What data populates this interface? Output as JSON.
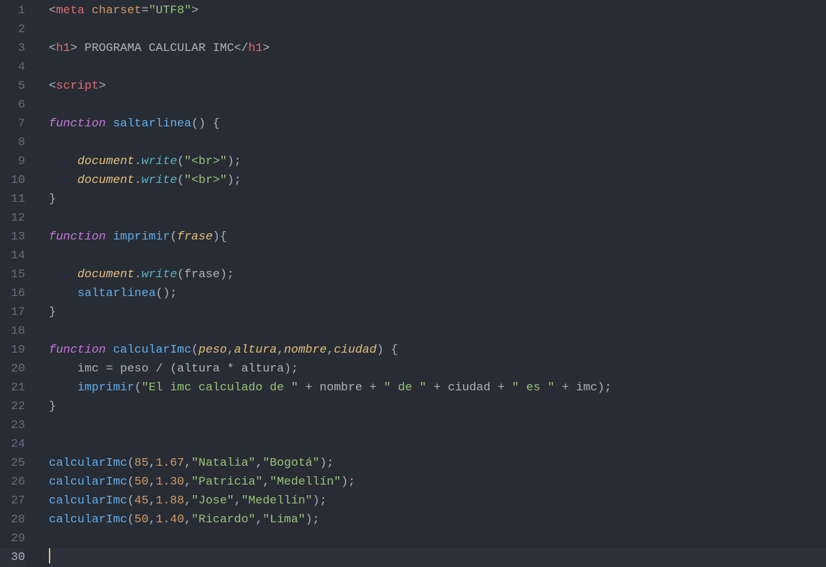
{
  "lineCount": 30,
  "currentLine": 30,
  "lines": [
    {
      "n": 1,
      "indent": 0,
      "tokens": [
        [
          "pun",
          "<"
        ],
        [
          "tag",
          "meta"
        ],
        [
          "txt",
          " "
        ],
        [
          "attr",
          "charset"
        ],
        [
          "pun",
          "="
        ],
        [
          "str",
          "\"UTF8\""
        ],
        [
          "pun",
          ">"
        ]
      ]
    },
    {
      "n": 2,
      "indent": 0,
      "tokens": []
    },
    {
      "n": 3,
      "indent": 0,
      "tokens": [
        [
          "pun",
          "<"
        ],
        [
          "tag",
          "h1"
        ],
        [
          "pun",
          ">"
        ],
        [
          "txt",
          " PROGRAMA CALCULAR IMC"
        ],
        [
          "pun",
          "</"
        ],
        [
          "tag",
          "h1"
        ],
        [
          "pun",
          ">"
        ]
      ]
    },
    {
      "n": 4,
      "indent": 0,
      "tokens": []
    },
    {
      "n": 5,
      "indent": 0,
      "tokens": [
        [
          "pun",
          "<"
        ],
        [
          "tag",
          "script"
        ],
        [
          "pun",
          ">"
        ]
      ]
    },
    {
      "n": 6,
      "indent": 0,
      "tokens": []
    },
    {
      "n": 7,
      "indent": 0,
      "tokens": [
        [
          "key",
          "function"
        ],
        [
          "txt",
          " "
        ],
        [
          "fn",
          "saltarlinea"
        ],
        [
          "pun",
          "() {"
        ]
      ]
    },
    {
      "n": 8,
      "indent": 0,
      "tokens": []
    },
    {
      "n": 9,
      "indent": 0,
      "tokens": [
        [
          "txt",
          "    "
        ],
        [
          "obj",
          "document"
        ],
        [
          "pun",
          "."
        ],
        [
          "fni",
          "write"
        ],
        [
          "pun",
          "("
        ],
        [
          "str",
          "\"<br>\""
        ],
        [
          "pun",
          ");"
        ]
      ]
    },
    {
      "n": 10,
      "indent": 0,
      "tokens": [
        [
          "txt",
          "    "
        ],
        [
          "obj",
          "document"
        ],
        [
          "pun",
          "."
        ],
        [
          "fni",
          "write"
        ],
        [
          "pun",
          "("
        ],
        [
          "str",
          "\"<br>\""
        ],
        [
          "pun",
          ");"
        ]
      ]
    },
    {
      "n": 11,
      "indent": 0,
      "tokens": [
        [
          "pun",
          "}"
        ]
      ]
    },
    {
      "n": 12,
      "indent": 0,
      "tokens": []
    },
    {
      "n": 13,
      "indent": 0,
      "tokens": [
        [
          "key",
          "function"
        ],
        [
          "txt",
          " "
        ],
        [
          "fn",
          "imprimir"
        ],
        [
          "pun",
          "("
        ],
        [
          "param",
          "frase"
        ],
        [
          "pun",
          "){  "
        ]
      ]
    },
    {
      "n": 14,
      "indent": 0,
      "tokens": []
    },
    {
      "n": 15,
      "indent": 0,
      "tokens": [
        [
          "txt",
          "    "
        ],
        [
          "obj",
          "document"
        ],
        [
          "pun",
          "."
        ],
        [
          "fni",
          "write"
        ],
        [
          "pun",
          "("
        ],
        [
          "txt",
          "frase"
        ],
        [
          "pun",
          ");"
        ]
      ]
    },
    {
      "n": 16,
      "indent": 0,
      "tokens": [
        [
          "txt",
          "    "
        ],
        [
          "fn",
          "saltarlinea"
        ],
        [
          "pun",
          "();"
        ]
      ]
    },
    {
      "n": 17,
      "indent": 0,
      "tokens": [
        [
          "pun",
          "}"
        ]
      ]
    },
    {
      "n": 18,
      "indent": 0,
      "tokens": []
    },
    {
      "n": 19,
      "indent": 0,
      "tokens": [
        [
          "key",
          "function"
        ],
        [
          "txt",
          " "
        ],
        [
          "fn",
          "calcularImc"
        ],
        [
          "pun",
          "("
        ],
        [
          "param",
          "peso"
        ],
        [
          "pun",
          ","
        ],
        [
          "param",
          "altura"
        ],
        [
          "pun",
          ","
        ],
        [
          "param",
          "nombre"
        ],
        [
          "pun",
          ","
        ],
        [
          "param",
          "ciudad"
        ],
        [
          "pun",
          ") {"
        ]
      ]
    },
    {
      "n": 20,
      "indent": 0,
      "tokens": [
        [
          "txt",
          "    imc "
        ],
        [
          "pun",
          "="
        ],
        [
          "txt",
          " peso "
        ],
        [
          "pun",
          "/"
        ],
        [
          "txt",
          " "
        ],
        [
          "pun",
          "("
        ],
        [
          "txt",
          "altura "
        ],
        [
          "pun",
          "*"
        ],
        [
          "txt",
          " altura"
        ],
        [
          "pun",
          ");"
        ]
      ]
    },
    {
      "n": 21,
      "indent": 0,
      "tokens": [
        [
          "txt",
          "    "
        ],
        [
          "fn",
          "imprimir"
        ],
        [
          "pun",
          "("
        ],
        [
          "str",
          "\"El imc calculado de \""
        ],
        [
          "txt",
          " "
        ],
        [
          "pun",
          "+"
        ],
        [
          "txt",
          " nombre "
        ],
        [
          "pun",
          "+"
        ],
        [
          "txt",
          " "
        ],
        [
          "str",
          "\" de \""
        ],
        [
          "txt",
          " "
        ],
        [
          "pun",
          "+"
        ],
        [
          "txt",
          " ciudad "
        ],
        [
          "pun",
          "+"
        ],
        [
          "txt",
          " "
        ],
        [
          "str",
          "\" es \""
        ],
        [
          "txt",
          " "
        ],
        [
          "pun",
          "+"
        ],
        [
          "txt",
          " imc"
        ],
        [
          "pun",
          ");"
        ]
      ]
    },
    {
      "n": 22,
      "indent": 0,
      "tokens": [
        [
          "pun",
          "}"
        ]
      ]
    },
    {
      "n": 23,
      "indent": 0,
      "tokens": []
    },
    {
      "n": 24,
      "indent": 0,
      "tokens": []
    },
    {
      "n": 25,
      "indent": 0,
      "tokens": [
        [
          "fn",
          "calcularImc"
        ],
        [
          "pun",
          "("
        ],
        [
          "num",
          "85"
        ],
        [
          "pun",
          ","
        ],
        [
          "num",
          "1.67"
        ],
        [
          "pun",
          ","
        ],
        [
          "str",
          "\"Natalia\""
        ],
        [
          "pun",
          ","
        ],
        [
          "str",
          "\"Bogotá\""
        ],
        [
          "pun",
          ");"
        ]
      ]
    },
    {
      "n": 26,
      "indent": 0,
      "tokens": [
        [
          "fn",
          "calcularImc"
        ],
        [
          "pun",
          "("
        ],
        [
          "num",
          "50"
        ],
        [
          "pun",
          ","
        ],
        [
          "num",
          "1.30"
        ],
        [
          "pun",
          ","
        ],
        [
          "str",
          "\"Patricia\""
        ],
        [
          "pun",
          ","
        ],
        [
          "str",
          "\"Medellín\""
        ],
        [
          "pun",
          ");"
        ]
      ]
    },
    {
      "n": 27,
      "indent": 0,
      "tokens": [
        [
          "fn",
          "calcularImc"
        ],
        [
          "pun",
          "("
        ],
        [
          "num",
          "45"
        ],
        [
          "pun",
          ","
        ],
        [
          "num",
          "1.88"
        ],
        [
          "pun",
          ","
        ],
        [
          "str",
          "\"Jose\""
        ],
        [
          "pun",
          ","
        ],
        [
          "str",
          "\"Medellín\""
        ],
        [
          "pun",
          ");"
        ]
      ]
    },
    {
      "n": 28,
      "indent": 0,
      "tokens": [
        [
          "fn",
          "calcularImc"
        ],
        [
          "pun",
          "("
        ],
        [
          "num",
          "50"
        ],
        [
          "pun",
          ","
        ],
        [
          "num",
          "1.40"
        ],
        [
          "pun",
          ","
        ],
        [
          "str",
          "\"Ricardo\""
        ],
        [
          "pun",
          ","
        ],
        [
          "str",
          "\"Lima\""
        ],
        [
          "pun",
          ");"
        ]
      ]
    },
    {
      "n": 29,
      "indent": 0,
      "tokens": []
    },
    {
      "n": 30,
      "indent": 0,
      "tokens": [],
      "cursor": true
    }
  ]
}
